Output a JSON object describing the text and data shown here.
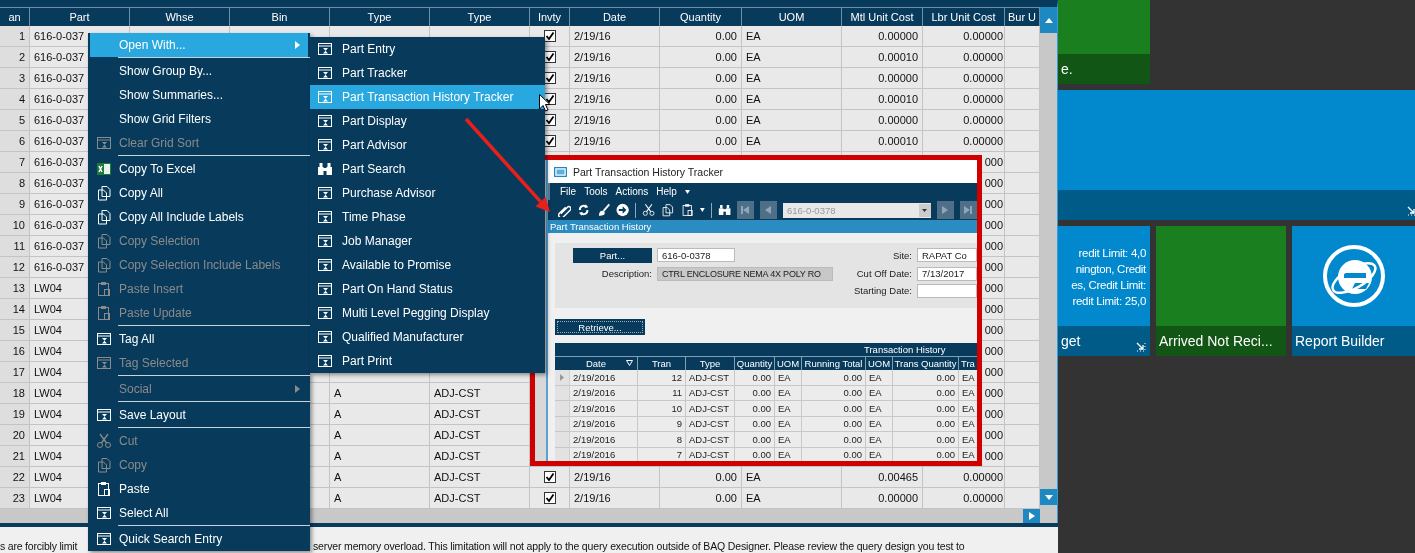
{
  "grid": {
    "columns": [
      "an",
      "Part",
      "Whse",
      "Bin",
      "Type",
      "Type",
      "Invty",
      "Date",
      "Quantity",
      "UOM",
      "Mtl Unit Cost",
      "Lbr Unit Cost",
      "Bur U"
    ],
    "rows": [
      {
        "number": "1",
        "part": "616-0-037",
        "invty": true,
        "date": "2/19/16",
        "quantity": "0.00",
        "uom": "EA",
        "mtl_unit_cost": "0.00000",
        "lbr_unit_cost": "0.00000"
      },
      {
        "number": "2",
        "part": "616-0-037",
        "invty": true,
        "date": "2/19/16",
        "quantity": "0.00",
        "uom": "EA",
        "mtl_unit_cost": "0.00010",
        "lbr_unit_cost": "0.00000"
      },
      {
        "number": "3",
        "part": "616-0-037",
        "invty": true,
        "date": "2/19/16",
        "quantity": "0.00",
        "uom": "EA",
        "mtl_unit_cost": "0.00000",
        "lbr_unit_cost": "0.00000"
      },
      {
        "number": "4",
        "part": "616-0-037",
        "invty": true,
        "date": "2/19/16",
        "quantity": "0.00",
        "uom": "EA",
        "mtl_unit_cost": "0.00010",
        "lbr_unit_cost": "0.00000"
      },
      {
        "number": "5",
        "part": "616-0-037",
        "invty": true,
        "date": "2/19/16",
        "quantity": "0.00",
        "uom": "EA",
        "mtl_unit_cost": "0.00000",
        "lbr_unit_cost": "0.00000"
      },
      {
        "number": "6",
        "part": "616-0-037",
        "invty": true,
        "date": "2/19/16",
        "quantity": "0.00",
        "uom": "EA",
        "mtl_unit_cost": "0.00010",
        "lbr_unit_cost": "0.00000"
      },
      {
        "number": "7",
        "part": "616-0-037",
        "lbr_unit_cost": "000"
      },
      {
        "number": "8",
        "part": "616-0-037",
        "lbr_unit_cost": "000"
      },
      {
        "number": "9",
        "part": "616-0-037",
        "lbr_unit_cost": "000"
      },
      {
        "number": "10",
        "part": "616-0-037",
        "lbr_unit_cost": "000"
      },
      {
        "number": "11",
        "part": "616-0-037",
        "lbr_unit_cost": "000"
      },
      {
        "number": "12",
        "part": "616-0-037",
        "lbr_unit_cost": "000"
      },
      {
        "number": "13",
        "part": "LW04",
        "lbr_unit_cost": "000"
      },
      {
        "number": "14",
        "part": "LW04",
        "lbr_unit_cost": "000"
      },
      {
        "number": "15",
        "part": "LW04",
        "lbr_unit_cost": "000"
      },
      {
        "number": "16",
        "part": "LW04",
        "lbr_unit_cost": "000"
      },
      {
        "number": "17",
        "part": "LW04",
        "lbr_unit_cost": "000"
      },
      {
        "number": "18",
        "part": "LW04",
        "type": "A",
        "type_2": "ADJ-CST",
        "lbr_unit_cost": "000"
      },
      {
        "number": "19",
        "part": "LW04",
        "type": "A",
        "type_2": "ADJ-CST",
        "lbr_unit_cost": "000"
      },
      {
        "number": "20",
        "part": "LW04",
        "type": "A",
        "type_2": "ADJ-CST",
        "lbr_unit_cost": "000"
      },
      {
        "number": "21",
        "part": "LW04",
        "type": "A",
        "type_2": "ADJ-CST",
        "lbr_unit_cost": "000"
      },
      {
        "number": "22",
        "part": "LW04",
        "type": "A",
        "type_2": "ADJ-CST",
        "invty": true,
        "date": "2/19/16",
        "quantity": "0.00",
        "uom": "EA",
        "mtl_unit_cost": "0.00465",
        "lbr_unit_cost": "0.00000"
      },
      {
        "number": "23",
        "part": "LW04",
        "type": "A",
        "type_2": "ADJ-CST",
        "invty": true,
        "date": "2/19/16",
        "quantity": "0.00",
        "uom": "EA",
        "mtl_unit_cost": "0.00000",
        "lbr_unit_cost": "0.00000"
      }
    ]
  },
  "status_bar": {
    "message_parts": [
      "s are forcibly limit",
      "server memory overload. This limitation will not apply to the query execution outside of  BAQ Designer.  Please review the query design you test to"
    ]
  },
  "context_menu": {
    "groups": [
      [
        {
          "label": "Open With...",
          "kind": "submenu",
          "selected": true,
          "disabled": false,
          "children": [
            {
              "label": "Part Entry",
              "selected": false
            },
            {
              "label": "Part Tracker",
              "selected": false
            },
            {
              "label": "Part Transaction History Tracker",
              "selected": true
            },
            {
              "label": "Part Display",
              "selected": false
            },
            {
              "label": "Part Advisor",
              "selected": false
            },
            {
              "label": "Part Search",
              "selected": false
            },
            {
              "label": "Purchase Advisor",
              "selected": false
            },
            {
              "label": "Time Phase",
              "selected": false
            },
            {
              "label": "Job Manager",
              "selected": false
            },
            {
              "label": "Available to Promise",
              "selected": false
            },
            {
              "label": "Part On Hand Status",
              "selected": false
            },
            {
              "label": "Multi Level Pegging Display",
              "selected": false
            },
            {
              "label": "Qualified Manufacturer",
              "selected": false
            },
            {
              "label": "Part Print",
              "selected": false
            }
          ]
        }
      ],
      [
        {
          "label": "Show Group By...",
          "kind": "command",
          "selected": false,
          "disabled": false
        },
        {
          "label": "Show Summaries...",
          "kind": "command",
          "selected": false,
          "disabled": false
        },
        {
          "label": "Show Grid Filters",
          "kind": "command",
          "selected": false,
          "disabled": false
        },
        {
          "label": "Clear Grid Sort",
          "kind": "command",
          "selected": false,
          "disabled": true
        }
      ],
      [
        {
          "label": "Copy To Excel",
          "kind": "command",
          "selected": false,
          "disabled": false
        },
        {
          "label": "Copy All",
          "kind": "command",
          "selected": false,
          "disabled": false
        },
        {
          "label": "Copy All Include Labels",
          "kind": "command",
          "selected": false,
          "disabled": false
        },
        {
          "label": "Copy Selection",
          "kind": "command",
          "selected": false,
          "disabled": true
        },
        {
          "label": "Copy Selection Include Labels",
          "kind": "command",
          "selected": false,
          "disabled": true
        },
        {
          "label": "Paste Insert",
          "kind": "command",
          "selected": false,
          "disabled": true
        },
        {
          "label": "Paste Update",
          "kind": "command",
          "selected": false,
          "disabled": true
        }
      ],
      [
        {
          "label": "Tag All",
          "kind": "command",
          "selected": false,
          "disabled": false
        },
        {
          "label": "Tag Selected",
          "kind": "command",
          "selected": false,
          "disabled": true
        }
      ],
      [
        {
          "label": "Social",
          "kind": "submenu",
          "selected": false,
          "disabled": true
        }
      ],
      [
        {
          "label": "Save Layout",
          "kind": "command",
          "selected": false,
          "disabled": false
        }
      ],
      [
        {
          "label": "Cut",
          "kind": "command",
          "selected": false,
          "disabled": true
        },
        {
          "label": "Copy",
          "kind": "command",
          "selected": false,
          "disabled": true
        },
        {
          "label": "Paste",
          "kind": "command",
          "selected": false,
          "disabled": false
        },
        {
          "label": "Select All",
          "kind": "command",
          "selected": false,
          "disabled": false
        }
      ],
      [
        {
          "label": "Quick Search Entry",
          "kind": "command",
          "selected": false,
          "disabled": false
        }
      ]
    ]
  },
  "tracker_window": {
    "title": "Part Transaction History Tracker",
    "menu": [
      "File",
      "Tools",
      "Actions",
      "Help"
    ],
    "toolbar_combo": "616-0-0378",
    "section": "Part Transaction History",
    "part_button": "Part...",
    "part_value": "616-0-0378",
    "description_label": "Description:",
    "description_value": "CTRL ENCLOSURE NEMA 4X POLY RO",
    "site_label": "Site:",
    "site_value": "RAPAT Co",
    "cut_off_label": "Cut Off Date:",
    "cut_off_value": "7/13/2017",
    "starting_label": "Starting Date:",
    "retrieve_button": "Retrieve...",
    "history": {
      "title": "Transaction History",
      "columns": [
        "Date",
        "Tran",
        "Type",
        "Quantity",
        "UOM",
        "Running Total",
        "UOM",
        "Trans Quantity",
        "Tra"
      ],
      "rows": [
        {
          "selected": true,
          "cells": [
            "2/19/2016",
            "12",
            "ADJ-CST",
            "0.00",
            "EA",
            "0.00",
            "EA",
            "0.00",
            "EA"
          ]
        },
        {
          "selected": false,
          "cells": [
            "2/19/2016",
            "11",
            "ADJ-CST",
            "0.00",
            "EA",
            "0.00",
            "EA",
            "0.00",
            "EA"
          ]
        },
        {
          "selected": false,
          "cells": [
            "2/19/2016",
            "10",
            "ADJ-CST",
            "0.00",
            "EA",
            "0.00",
            "EA",
            "0.00",
            "EA"
          ]
        },
        {
          "selected": false,
          "cells": [
            "2/19/2016",
            "9",
            "ADJ-CST",
            "0.00",
            "EA",
            "0.00",
            "EA",
            "0.00",
            "EA"
          ]
        },
        {
          "selected": false,
          "cells": [
            "2/19/2016",
            "8",
            "ADJ-CST",
            "0.00",
            "EA",
            "0.00",
            "EA",
            "0.00",
            "EA"
          ]
        },
        {
          "selected": false,
          "cells": [
            "2/19/2016",
            "7",
            "ADJ-CST",
            "0.00",
            "EA",
            "0.00",
            "EA",
            "0.00",
            "EA"
          ]
        }
      ]
    }
  },
  "tiles": [
    {
      "color": "#1a801f",
      "label": "e."
    },
    {
      "color": "#0288cc"
    },
    {
      "color": "#0288cc",
      "lines": [
        "redit Limit: 4,0",
        "nington, Credit",
        "es, Credit Limit:",
        "redit Limit: 25,0"
      ],
      "label": "get"
    },
    {
      "color": "#1a801f",
      "label": "Arrived Not Reci..."
    },
    {
      "color": "#0288cc",
      "label": "Report Builder"
    }
  ]
}
